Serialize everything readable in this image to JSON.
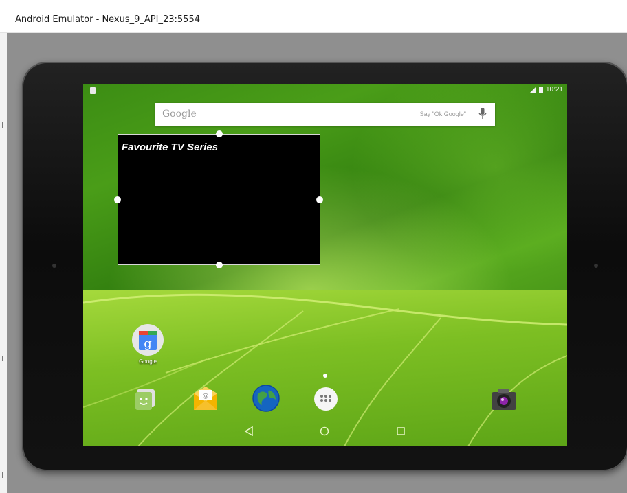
{
  "window": {
    "title": "Android Emulator - Nexus_9_API_23:5554"
  },
  "status_bar": {
    "time": "10:21"
  },
  "search_bar": {
    "logo_text": "Google",
    "hint": "Say \"Ok Google\""
  },
  "widget": {
    "title": "Favourite TV Series"
  },
  "home": {
    "apps": [
      {
        "label": "Google"
      }
    ],
    "dock_icons": [
      "messenger-icon",
      "email-icon",
      "browser-icon",
      "app-drawer-icon",
      "camera-icon"
    ],
    "nav_icons": [
      "back-icon",
      "home-icon",
      "recents-icon"
    ]
  },
  "colors": {
    "title_bar": "#ffffff",
    "frame": "#8f8f8f",
    "widget_bg": "#000000",
    "wallpaper_green": "#4a9d18"
  }
}
